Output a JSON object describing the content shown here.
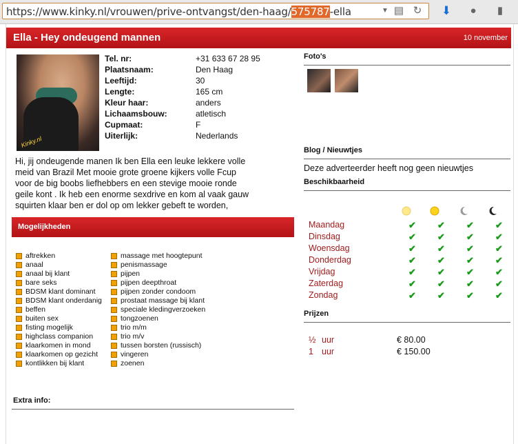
{
  "browser": {
    "url_prefix": "https://www.kinky.nl/vrouwen/prive-ontvangst/den-haag/",
    "url_highlight": "575787",
    "url_suffix": "-ella"
  },
  "header": {
    "title": "Ella - Hey ondeugend mannen",
    "date": "10 november"
  },
  "specs": [
    {
      "key": "Tel. nr:",
      "value": "+31 633 67 28 95"
    },
    {
      "key": "Plaatsnaam:",
      "value": "Den Haag"
    },
    {
      "key": "Leeftijd:",
      "value": "30"
    },
    {
      "key": "Lengte:",
      "value": "165 cm"
    },
    {
      "key": "Kleur haar:",
      "value": "anders"
    },
    {
      "key": "Lichaamsbouw:",
      "value": "atletisch"
    },
    {
      "key": "Cupmaat:",
      "value": "F"
    },
    {
      "key": "Uiterlijk:",
      "value": "Nederlands"
    }
  ],
  "photo_watermark": "Kinky.nl",
  "bio_lines": [
    "Hi, jij ondeugende manen Ik ben Ella een leuke lekkere volle",
    "meid van Brazil Met mooie grote groene kijkers volle Fcup",
    "voor de big boobs liefhebbers en een stevige mooie ronde",
    "geile kont . Ik heb een enorme sexdrive en kom al vaak gauw",
    "squirten klaar ben er dol op om lekker gebeft te worden,"
  ],
  "mogelijkheden_title": "Mogelijkheden",
  "mogelijkheden_col1": [
    "aftrekken",
    "anaal",
    "anaal bij klant",
    "bare seks",
    "BDSM klant dominant",
    "BDSM klant onderdanig",
    "beffen",
    "buiten sex",
    "fisting mogelijk",
    "highclass companion",
    "klaarkomen in mond",
    "klaarkomen op gezicht",
    "kontlikken bij klant"
  ],
  "mogelijkheden_col2": [
    "massage met hoogtepunt",
    "penismassage",
    "pijpen",
    "pijpen deepthroat",
    "pijpen zonder condoom",
    "prostaat massage bij klant",
    "speciale kledingverzoeken",
    "tongzoenen",
    "trio m/m",
    "trio m/v",
    "tussen borsten (russisch)",
    "vingeren",
    "zoenen"
  ],
  "extra_info_title": "Extra info:",
  "fotos_title": "Foto's",
  "blog_title": "Blog / Nieuwtjes",
  "blog_text": "Deze adverteerder heeft nog geen nieuwtjes",
  "beschikbaarheid_title": "Beschikbaarheid",
  "days": [
    "Maandag",
    "Dinsdag",
    "Woensdag",
    "Donderdag",
    "Vrijdag",
    "Zaterdag",
    "Zondag"
  ],
  "time_icons": [
    "morning-sun-icon",
    "day-sun-icon",
    "evening-moon-icon",
    "night-moon-icon"
  ],
  "prijzen_title": "Prijzen",
  "prices": [
    {
      "duration": "½",
      "unit": "uur",
      "amount": "€ 80.00"
    },
    {
      "duration": "1",
      "unit": "uur",
      "amount": "€ 150.00"
    }
  ],
  "colors": {
    "brand_red": "#c4161a",
    "day_red": "#a21c1c",
    "check_green": "#1a9a1a",
    "bullet_orange": "#f0a000"
  }
}
